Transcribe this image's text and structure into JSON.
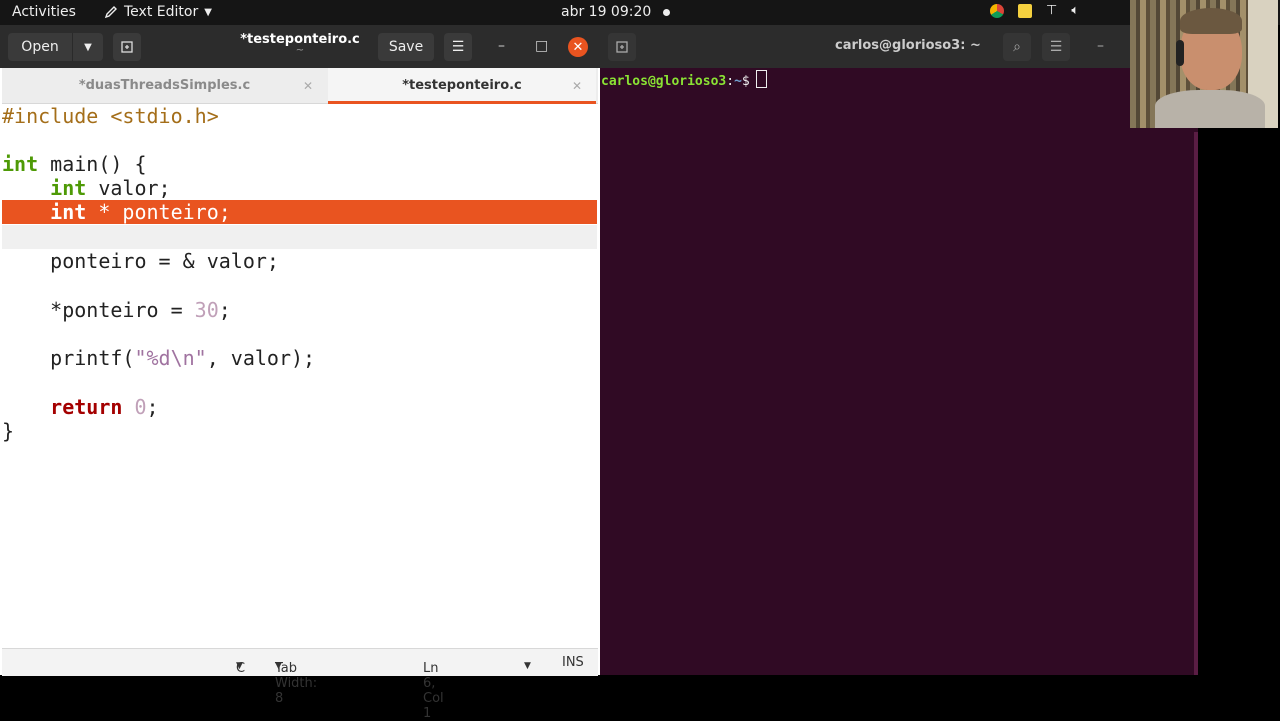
{
  "topbar": {
    "activities": "Activities",
    "app_name": "Text Editor",
    "clock": "abr 19  09:20"
  },
  "gedit": {
    "open_label": "Open",
    "save_label": "Save",
    "title": "*testeponteiro.c",
    "subtitle": "~",
    "tabs": [
      {
        "label": "*duasThreadsSimples.c",
        "active": false
      },
      {
        "label": "*testeponteiro.c",
        "active": true
      }
    ],
    "code_lines": [
      "#include <stdio.h>",
      "",
      "int main() {",
      "    int valor;",
      "    int * ponteiro;",
      "",
      "    ponteiro = & valor;",
      "",
      "    *ponteiro = 30;",
      "",
      "    printf(\"%d\\n\", valor);",
      "",
      "    return 0;",
      "}"
    ],
    "status": {
      "language": "C",
      "tab_width": "Tab Width: 8",
      "position": "Ln 6, Col 1",
      "mode": "INS"
    }
  },
  "terminal": {
    "title": "carlos@glorioso3: ~",
    "prompt_user": "carlos@glorioso3",
    "prompt_sep": ":",
    "prompt_path": "~",
    "prompt_symbol": "$"
  },
  "colors": {
    "accent": "#e95420",
    "terminal_bg": "#300a24",
    "keyword": "#4e9a06"
  }
}
